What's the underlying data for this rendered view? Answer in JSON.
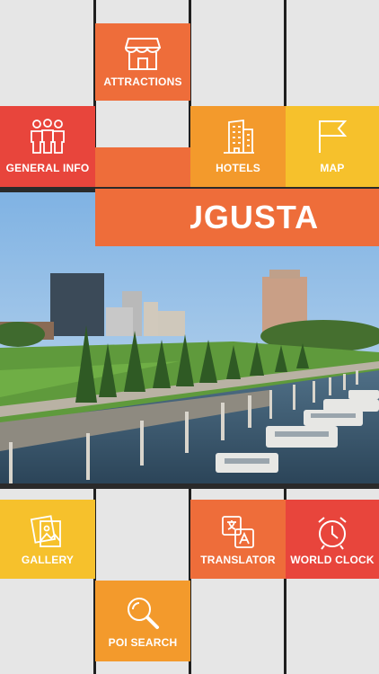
{
  "app": {
    "city_title": "AUGUSTA"
  },
  "tiles": {
    "attractions": {
      "label": "ATTRACTIONS",
      "icon": "storefront-icon",
      "color": "#ee6d3a"
    },
    "general_info": {
      "label": "GENERAL INFO",
      "icon": "people-icon",
      "color": "#e8453c"
    },
    "hotels": {
      "label": "HOTELS",
      "icon": "hotel-building-icon",
      "color": "#f39a2c"
    },
    "map": {
      "label": "MAP",
      "icon": "flag-icon",
      "color": "#f6c12c"
    },
    "gallery": {
      "label": "GALLERY",
      "icon": "gallery-icon",
      "color": "#f6c12c"
    },
    "translator": {
      "label": "TRANSLATOR",
      "icon": "translate-icon",
      "color": "#ee6d3a"
    },
    "world_clock": {
      "label": "WORLD CLOCK",
      "icon": "alarm-clock-icon",
      "color": "#e8453c"
    },
    "poi_search": {
      "label": "POI SEARCH",
      "icon": "magnifier-icon",
      "color": "#f39a2c"
    }
  }
}
